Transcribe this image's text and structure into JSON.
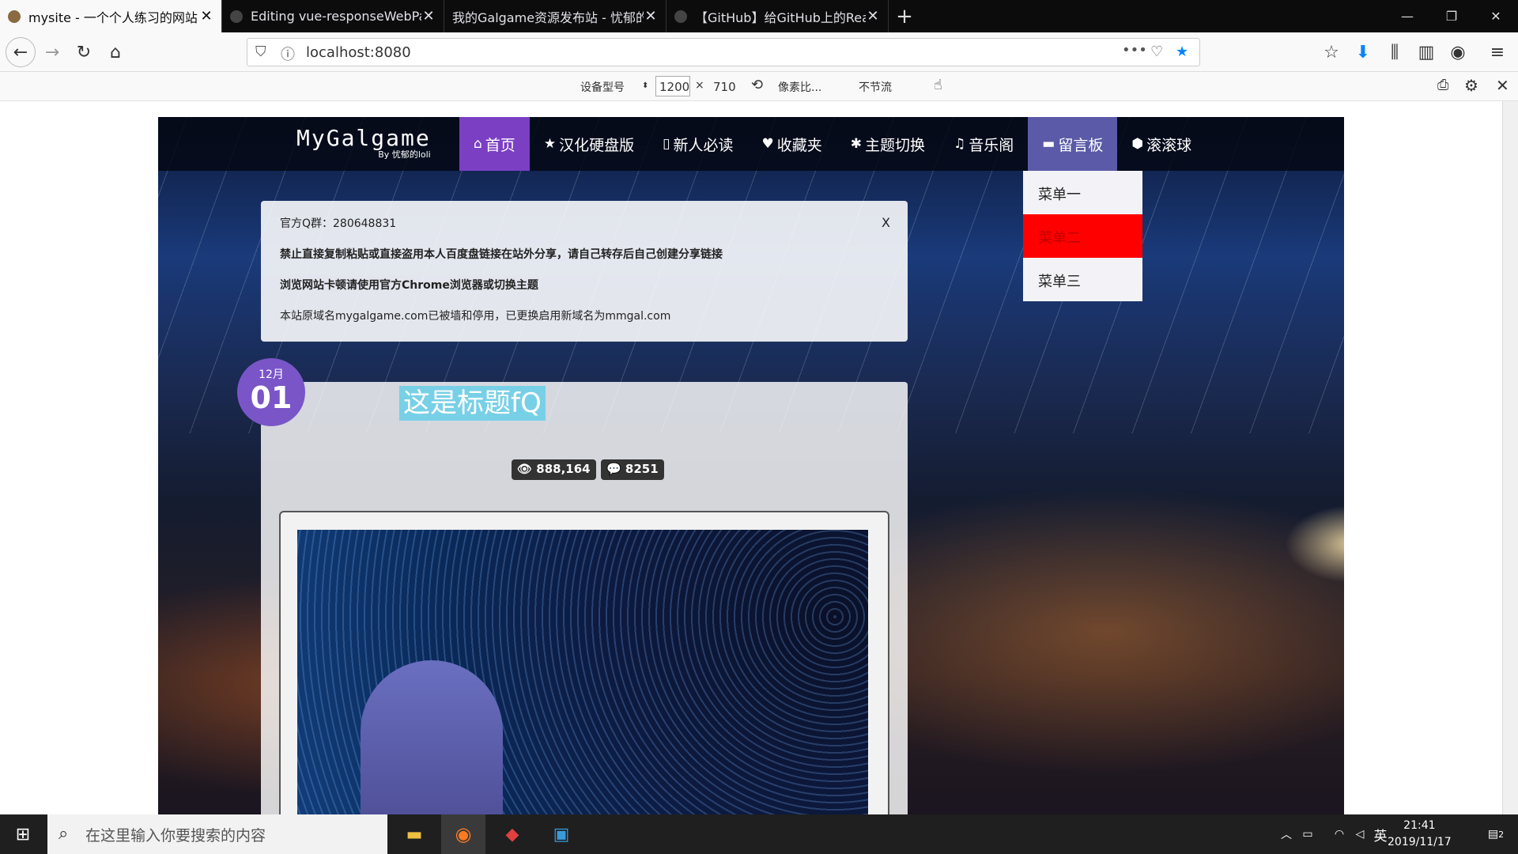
{
  "browser": {
    "tabs": [
      {
        "title": "mysite - 一个个人练习的网站",
        "active": true
      },
      {
        "title": "Editing vue-responseWebPa",
        "active": false
      },
      {
        "title": "我的Galgame资源发布站 - 忧郁的",
        "active": false
      },
      {
        "title": "【GitHub】给GitHub上的Rea",
        "active": false
      }
    ],
    "url": "localhost:8080",
    "responsive": {
      "device_label": "设备型号",
      "width": "1200",
      "times": "×",
      "height": "710",
      "dpr_label": "像素比...",
      "throttle_label": "不节流"
    }
  },
  "site": {
    "logo_main": "MyGalgame",
    "logo_sub": "By 忧郁的loli",
    "menu": [
      {
        "icon": "⌂",
        "label": "首页"
      },
      {
        "icon": "★",
        "label": "汉化硬盘版"
      },
      {
        "icon": "▯",
        "label": "新人必读"
      },
      {
        "icon": "♥",
        "label": "收藏夹"
      },
      {
        "icon": "✱",
        "label": "主题切换"
      },
      {
        "icon": "♫",
        "label": "音乐阁"
      },
      {
        "icon": "▬",
        "label": "留言板"
      },
      {
        "icon": "⬢",
        "label": "滚滚球"
      }
    ],
    "dropdown": [
      "菜单一",
      "菜单二",
      "菜单三"
    ],
    "notice": {
      "qq": "官方Q群：280648831",
      "warn1": "禁止直接复制粘贴或直接盗用本人百度盘链接在站外分享，请自己转存后自己创建分享链接",
      "warn2": "浏览网站卡顿请使用官方Chrome浏览器或切换主题",
      "domain": "本站原域名mygalgame.com已被墙和停用，已更换启用新域名为mmgal.com",
      "close": "X"
    },
    "post": {
      "month": "12月",
      "day": "01",
      "title": "这是标题fQ",
      "views": "888,164",
      "comments": "8251"
    }
  },
  "taskbar": {
    "search_placeholder": "在这里输入你要搜索的内容",
    "ime": "英",
    "time": "21:41",
    "date": "2019/11/17",
    "notifications": "2"
  }
}
